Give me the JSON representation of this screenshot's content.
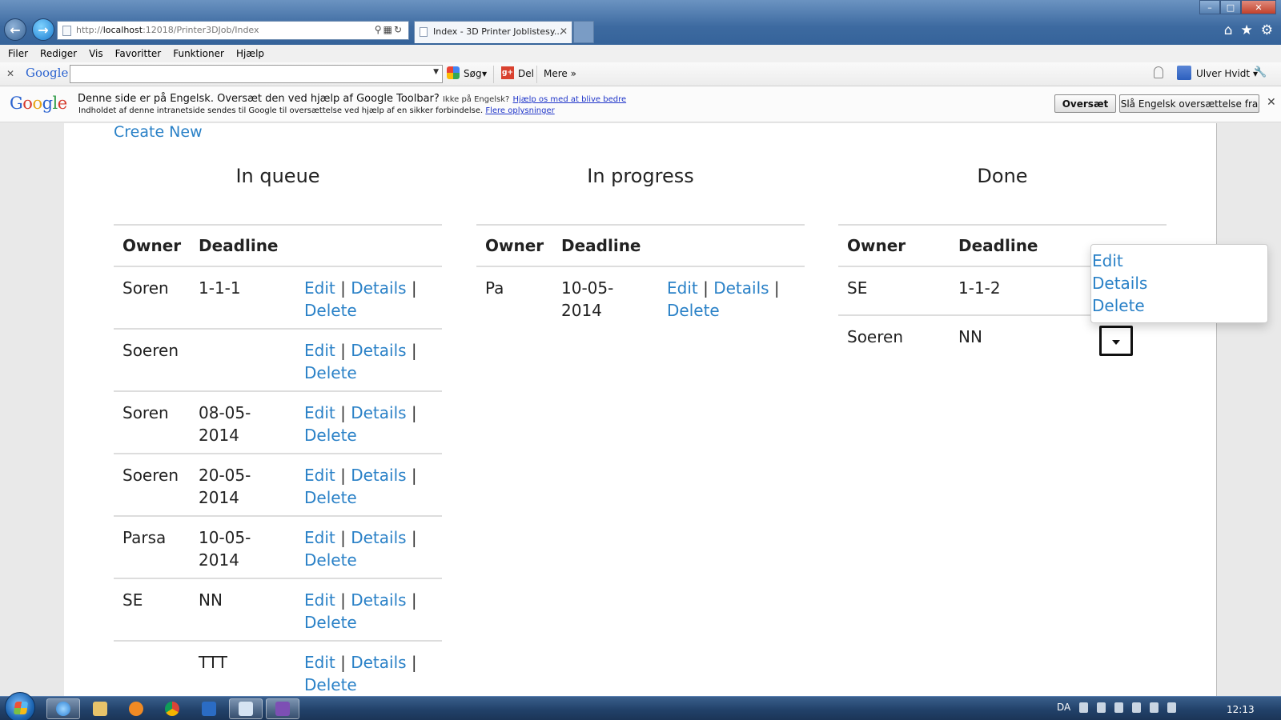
{
  "browser": {
    "url_prefix": "http://",
    "url_host": "localhost",
    "url_rest": ":12018/Printer3DJob/Index",
    "tab_title": "Index - 3D Printer Joblistesy...",
    "menu": [
      "Filer",
      "Rediger",
      "Vis",
      "Favoritter",
      "Funktioner",
      "Hjælp"
    ]
  },
  "google_toolbar": {
    "logo": "Google",
    "search_value": "",
    "search_label": "Søg",
    "share_label": "Del",
    "more_label": "Mere »",
    "user_label": "Ulver Hvidt ▾"
  },
  "translate_bar": {
    "logo": "Google",
    "message": "Denne side er på Engelsk. Oversæt den ved hjælp af Google Toolbar?",
    "not_english": "Ikke på Engelsk?",
    "help_link": "Hjælp os med at blive bedre",
    "privacy_note": "Indholdet af denne intranetside sendes til Google til oversættelse ved hjælp af en sikker forbindelse.",
    "more_info_link": "Flere oplysninger",
    "translate_button": "Oversæt",
    "turn_off_button": "Slå Engelsk oversættelse fra"
  },
  "page": {
    "create_new": "Create New",
    "headers": {
      "owner": "Owner",
      "deadline": "Deadline"
    },
    "actions": {
      "edit": "Edit",
      "details": "Details",
      "delete": "Delete",
      "sep": "|"
    },
    "queue": {
      "title": "In queue",
      "rows": [
        {
          "owner": "Soren",
          "deadline": "1-1-1"
        },
        {
          "owner": "Soeren",
          "deadline": ""
        },
        {
          "owner": "Soren",
          "deadline": "08-05-2014"
        },
        {
          "owner": "Soeren",
          "deadline": "20-05-2014"
        },
        {
          "owner": "Parsa",
          "deadline": "10-05-2014"
        },
        {
          "owner": "SE",
          "deadline": "NN"
        },
        {
          "owner": "",
          "deadline": "TTT"
        }
      ]
    },
    "progress": {
      "title": "In progress",
      "rows": [
        {
          "owner": "Pa",
          "deadline": "10-05-2014"
        }
      ]
    },
    "done": {
      "title": "Done",
      "rows": [
        {
          "owner": "SE",
          "deadline": "1-1-2"
        },
        {
          "owner": "Soeren",
          "deadline": "NN"
        }
      ]
    },
    "dropdown_menu": [
      "Edit",
      "Details",
      "Delete"
    ]
  },
  "taskbar": {
    "language": "DA",
    "clock": "12:13"
  },
  "colors": {
    "link": "#2a81c7",
    "title_bar": "#3d6aa0",
    "taskbar": "#22426a"
  }
}
